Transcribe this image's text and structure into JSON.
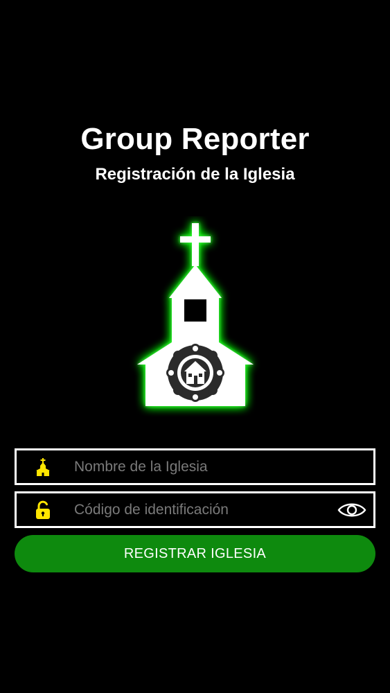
{
  "header": {
    "title": "Group Reporter",
    "subtitle": "Registración de la Iglesia"
  },
  "logo": {
    "icon": "church-icon",
    "glow_color": "#00ff00",
    "building_color": "#ffffff",
    "emblem_color": "#2b2b2b"
  },
  "form": {
    "church_name": {
      "icon": "church-small-icon",
      "placeholder": "Nombre de la Iglesia",
      "value": ""
    },
    "id_code": {
      "icon": "unlock-icon",
      "placeholder": "Código de identificación",
      "value": "",
      "toggle_icon": "eye-icon"
    },
    "submit_label": "REGISTRAR IGLESIA"
  },
  "colors": {
    "background": "#000000",
    "accent": "#0e8a0e",
    "icon_yellow": "#ffe600",
    "border": "#ffffff"
  }
}
